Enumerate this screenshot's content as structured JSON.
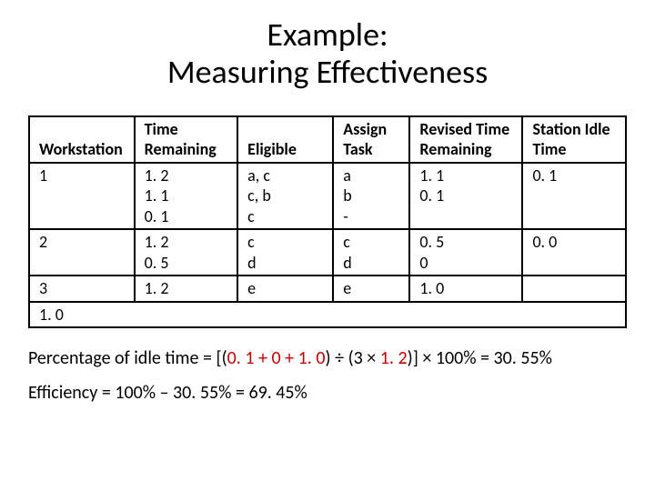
{
  "title_line1": "Example:",
  "title_line2": "Measuring Effectiveness",
  "headers": {
    "workstation": "Workstation",
    "time_remaining": "Time Remaining",
    "eligible": "Eligible",
    "assign_task": "Assign Task",
    "revised_time_remaining": "Revised Time Remaining",
    "station_idle_time": "Station Idle Time"
  },
  "rows": [
    {
      "workstation": "1",
      "time_remaining": "1. 2\n1. 1\n0. 1",
      "eligible": "a, c\nc, b\nc",
      "assign_task": "a\nb\n-",
      "revised_time_remaining": "1. 1\n0. 1",
      "station_idle_time": "0. 1"
    },
    {
      "workstation": "2",
      "time_remaining": "1. 2\n0. 5",
      "eligible": "c\nd",
      "assign_task": "c\nd",
      "revised_time_remaining": "0. 5\n0",
      "station_idle_time": "0. 0"
    },
    {
      "workstation": "3",
      "time_remaining": "1. 2",
      "eligible": "e",
      "assign_task": "e",
      "revised_time_remaining": "1. 0",
      "station_idle_time": ""
    }
  ],
  "total_idle": "1. 0",
  "calc": {
    "line1_pre": "Percentage of idle time = [(",
    "line1_idle": "0. 1 + 0 + 1. 0",
    "line1_mid": ") ÷ (3 × ",
    "line1_cycle": "1. 2",
    "line1_post": ")] × 100% =  30. 55%",
    "line2": "Efficiency = 100% – 30. 55% = 69. 45%"
  },
  "chart_data": {
    "type": "table",
    "columns": [
      "Workstation",
      "Time Remaining",
      "Eligible",
      "Assign Task",
      "Revised Time Remaining",
      "Station Idle Time"
    ],
    "rows": [
      [
        "1",
        "1.2 / 1.1 / 0.1",
        "a,c / c,b / c",
        "a / b / -",
        "1.1 / 0.1",
        "0.1"
      ],
      [
        "2",
        "1.2 / 0.5",
        "c / d",
        "c / d",
        "0.5 / 0",
        "0.0"
      ],
      [
        "3",
        "1.2",
        "e",
        "e",
        "1.0",
        ""
      ]
    ],
    "total_station_idle_time": 1.0,
    "percentage_idle_time": 30.55,
    "efficiency": 69.45,
    "cycle_time": 1.2,
    "num_stations": 3
  }
}
